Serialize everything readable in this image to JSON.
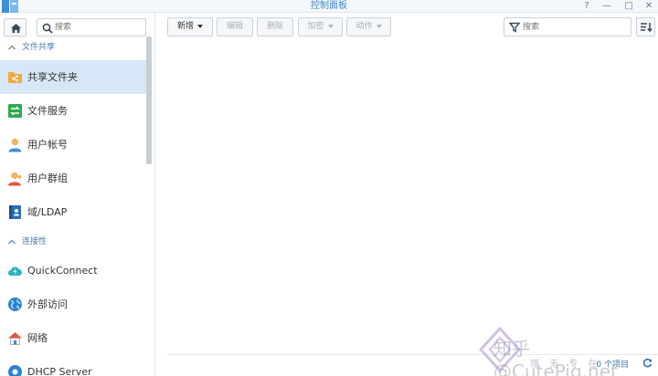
{
  "window": {
    "title": "控制面板"
  },
  "window_controls": {
    "help": "?",
    "minimize": "—",
    "maximize": "□",
    "close": "✕"
  },
  "sidebar": {
    "search_placeholder": "搜索",
    "sections": [
      {
        "label": "文件共享",
        "items": [
          {
            "label": "共享文件夹",
            "icon": "shared-folder-icon",
            "active": true
          },
          {
            "label": "文件服务",
            "icon": "file-services-icon"
          },
          {
            "label": "用户帐号",
            "icon": "user-icon"
          },
          {
            "label": "用户群组",
            "icon": "group-icon"
          },
          {
            "label": "域/LDAP",
            "icon": "domain-ldap-icon"
          }
        ]
      },
      {
        "label": "连接性",
        "items": [
          {
            "label": "QuickConnect",
            "icon": "quickconnect-icon"
          },
          {
            "label": "外部访问",
            "icon": "globe-icon"
          },
          {
            "label": "网络",
            "icon": "network-icon"
          },
          {
            "label": "DHCP Server",
            "icon": "dhcp-icon"
          }
        ]
      }
    ]
  },
  "toolbar": {
    "create": "新增",
    "edit": "编辑",
    "delete": "删除",
    "encrypt": "加密",
    "action": "动作",
    "filter_placeholder": "搜索"
  },
  "footer": {
    "item_count": "0 个项目"
  },
  "watermark": {
    "brand": "知乎 @CutePig.net",
    "subtitle": "理 无 专 在"
  },
  "colors": {
    "accent": "#3f86c8",
    "active_bg": "#d6e7f7",
    "section_label": "#4a7bab"
  }
}
